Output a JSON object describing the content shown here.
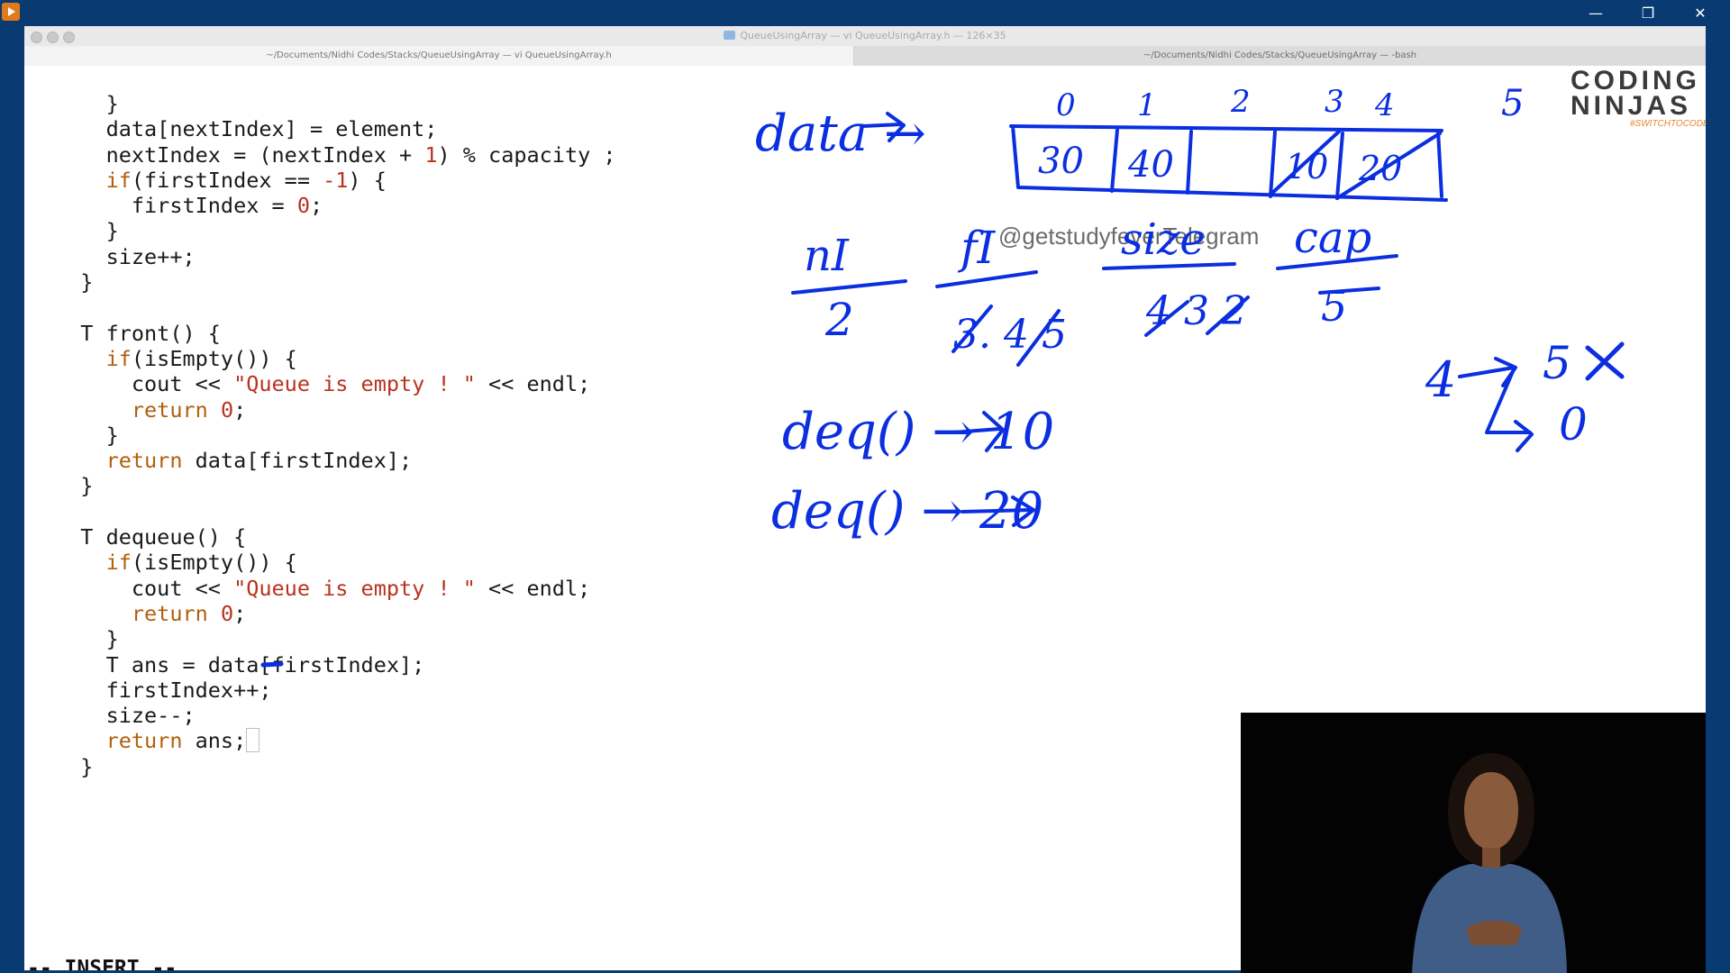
{
  "window": {
    "mac_title": "QueueUsingArray — vi QueueUsingArray.h — 126×35",
    "controls": {
      "minimize": "—",
      "restore": "❐",
      "close": "✕"
    }
  },
  "tabs": [
    {
      "label": "~/Documents/Nidhi Codes/Stacks/QueueUsingArray — vi QueueUsingArray.h"
    },
    {
      "label": "~/Documents/Nidhi Codes/Stacks/QueueUsingArray — -bash"
    }
  ],
  "editor": {
    "mode": "-- INSERT --",
    "lines": [
      "    }",
      "    data[nextIndex] = element;",
      "    nextIndex = (nextIndex + 1) % capacity ;",
      "    if(firstIndex == -1) {",
      "      firstIndex = 0;",
      "    }",
      "    size++;",
      "  }",
      "",
      "  T front() {",
      "    if(isEmpty()) {",
      "      cout << \"Queue is empty ! \" << endl;",
      "      return 0;",
      "    }",
      "    return data[firstIndex];",
      "  }",
      "",
      "  T dequeue() {",
      "    if(isEmpty()) {",
      "      cout << \"Queue is empty ! \" << endl;",
      "      return 0;",
      "    }",
      "    T ans = data[firstIndex];",
      "    firstIndex++;",
      "    size--;",
      "    return ans;",
      "  }"
    ]
  },
  "annotations": {
    "data_label": "data →",
    "indices": [
      "0",
      "1",
      "2",
      "3",
      "4",
      "5"
    ],
    "cells": [
      "30",
      "40",
      "",
      "10",
      "20"
    ],
    "vars": [
      {
        "name": "nI",
        "value": "2"
      },
      {
        "name": "fI",
        "value": "3. 4 5"
      },
      {
        "name": "size",
        "value": "4 3 2"
      },
      {
        "name": "cap",
        "value": "5"
      }
    ],
    "deq1": "deq() → 10",
    "deq2": "deq() → 20",
    "wrap": [
      "4",
      "5",
      "0"
    ]
  },
  "watermark": "@getstudyfeverTelegram",
  "logo": {
    "line1": "CODING",
    "line2": "NINJAS",
    "tagline": "#SWITCHTOCODE"
  },
  "colors": {
    "ink": "#0b2fe0",
    "keyword": "#b0600e",
    "string": "#b8331f",
    "titlebar": "#0a3a72"
  }
}
